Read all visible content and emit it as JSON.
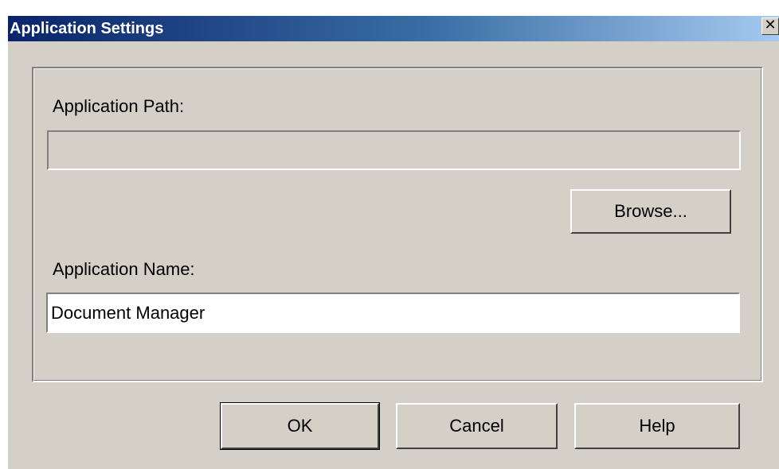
{
  "window": {
    "title": "Application Settings",
    "close_glyph": "✕"
  },
  "form": {
    "path_label": "Application Path:",
    "path_value": "",
    "browse_label": "Browse...",
    "name_label": "Application Name:",
    "name_value": "Document Manager"
  },
  "buttons": {
    "ok_label": "OK",
    "cancel_label": "Cancel",
    "help_label": "Help"
  },
  "colors": {
    "titlebar_start": "#0a246a",
    "titlebar_end": "#a6caf0",
    "dialog_face": "#d4d0c8"
  },
  "icons": {
    "close": "close-icon"
  }
}
